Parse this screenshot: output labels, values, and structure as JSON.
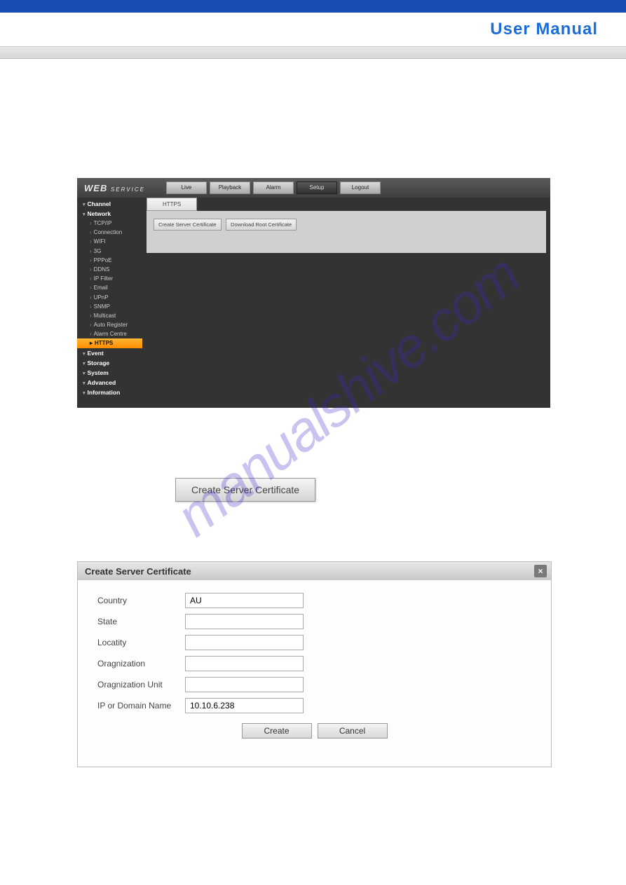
{
  "header": {
    "title": "User Manual"
  },
  "watermark": "manualshive.com",
  "app": {
    "logo_main": "WEB",
    "logo_sub": "SERVICE",
    "nav": [
      "Live",
      "Playback",
      "Alarm",
      "Setup",
      "Logout"
    ],
    "nav_active": "Setup",
    "sidebar": {
      "categories": [
        {
          "label": "Channel",
          "items": []
        },
        {
          "label": "Network",
          "items": [
            "TCP/IP",
            "Connection",
            "WIFI",
            "3G",
            "PPPoE",
            "DDNS",
            "IP Filter",
            "Email",
            "UPnP",
            "SNMP",
            "Multicast",
            "Auto Register",
            "Alarm Centre",
            "HTTPS"
          ]
        },
        {
          "label": "Event",
          "items": []
        },
        {
          "label": "Storage",
          "items": []
        },
        {
          "label": "System",
          "items": []
        },
        {
          "label": "Advanced",
          "items": []
        },
        {
          "label": "Information",
          "items": []
        }
      ],
      "active_item": "HTTPS"
    },
    "tab_label": "HTTPS",
    "panel_buttons": [
      "Create Server Certificate",
      "Download Root Certificate"
    ]
  },
  "big_button_label": "Create Server Certificate",
  "dialog": {
    "title": "Create Server Certificate",
    "fields": [
      {
        "label": "Country",
        "value": "AU"
      },
      {
        "label": "State",
        "value": ""
      },
      {
        "label": "Locatity",
        "value": ""
      },
      {
        "label": "Oragnization",
        "value": ""
      },
      {
        "label": "Oragnization Unit",
        "value": ""
      },
      {
        "label": "IP or Domain Name",
        "value": "10.10.6.238"
      }
    ],
    "create_label": "Create",
    "cancel_label": "Cancel"
  }
}
